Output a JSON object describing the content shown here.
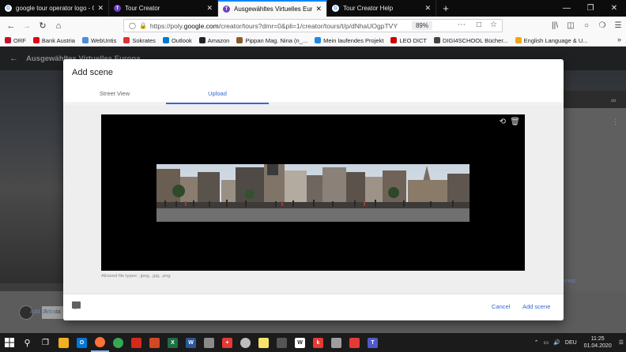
{
  "browser": {
    "tabs": [
      {
        "title": "google tour operator logo - Go",
        "favicon_color": "#ffffff",
        "favicon_glyph": "G",
        "active": false
      },
      {
        "title": "Tour Creator",
        "favicon_color": "#6f42c1",
        "favicon_glyph": "T",
        "active": false
      },
      {
        "title": "Ausgewähltes Virtuelles Europa",
        "favicon_color": "#6f42c1",
        "favicon_glyph": "T",
        "active": true
      },
      {
        "title": "Tour Creator Help",
        "favicon_color": "#ffffff",
        "favicon_glyph": "G",
        "active": false
      }
    ],
    "new_tab_icon": "plus-icon",
    "url_prefix": "https://poly.",
    "url_domain": "google.com",
    "url_rest": "/creator/tours?dmr=0&pli=1/creator/tours/t/p/dNhaUOgpTVY",
    "zoom": "89%",
    "bookmarks": [
      {
        "label": "ORF",
        "color": "#c8102e"
      },
      {
        "label": "Bank Austria",
        "color": "#e30613"
      },
      {
        "label": "WebUntis",
        "color": "#4a90d9"
      },
      {
        "label": "Sokrates",
        "color": "#d33"
      },
      {
        "label": "Outlook",
        "color": "#0078d4"
      },
      {
        "label": "Amazon",
        "color": "#222222"
      },
      {
        "label": "Pippan Mag. Nina (n_...",
        "color": "#8b5a2b"
      },
      {
        "label": "Mein laufendes Projekt",
        "color": "#1e88e5"
      },
      {
        "label": "LEO DICT",
        "color": "#cc0000"
      },
      {
        "label": "DIGI4SCHOOL Bücher...",
        "color": "#444444"
      },
      {
        "label": "English Language & U...",
        "color": "#f7a21b"
      }
    ]
  },
  "page": {
    "title": "Ausgewähltes Virtuelles Europa",
    "set_start": "Set sta",
    "add_scene_link": "Add scene",
    "interest_link": "erest"
  },
  "dialog": {
    "title": "Add scene",
    "tabs": {
      "street_view": "Street View",
      "upload": "Upload"
    },
    "active_tab": "Upload",
    "allowed_types": "Allowed file types: .jpeg, .jpg, .png",
    "cancel": "Cancel",
    "add_scene": "Add scene"
  },
  "taskbar": {
    "language": "DEU",
    "time": "11:25",
    "date": "01.04.2020",
    "apps": [
      {
        "name": "file-explorer",
        "color": "#f2b01e",
        "glyph": ""
      },
      {
        "name": "outlook",
        "color": "#0078d4",
        "glyph": "O"
      },
      {
        "name": "firefox",
        "color": "#ff7139",
        "glyph": ""
      },
      {
        "name": "chrome",
        "color": "#34a853",
        "glyph": ""
      },
      {
        "name": "acrobat",
        "color": "#d42a1d",
        "glyph": ""
      },
      {
        "name": "powerpoint",
        "color": "#d24726",
        "glyph": ""
      },
      {
        "name": "excel",
        "color": "#1d6f42",
        "glyph": "X"
      },
      {
        "name": "word",
        "color": "#2b579a",
        "glyph": "W"
      },
      {
        "name": "app-generic",
        "color": "#8a8a8a",
        "glyph": ""
      },
      {
        "name": "app-red",
        "color": "#e53935",
        "glyph": "+"
      },
      {
        "name": "app-ball",
        "color": "#bdbdbd",
        "glyph": ""
      },
      {
        "name": "sticky-notes",
        "color": "#f7e26b",
        "glyph": ""
      },
      {
        "name": "calculator",
        "color": "#555555",
        "glyph": ""
      },
      {
        "name": "app-w",
        "color": "#ffffff",
        "glyph": "W"
      },
      {
        "name": "app-k",
        "color": "#e53935",
        "glyph": "k"
      },
      {
        "name": "app-screen",
        "color": "#9e9e9e",
        "glyph": ""
      },
      {
        "name": "app-snip",
        "color": "#e53935",
        "glyph": ""
      },
      {
        "name": "teams",
        "color": "#5059c9",
        "glyph": "T"
      }
    ]
  }
}
